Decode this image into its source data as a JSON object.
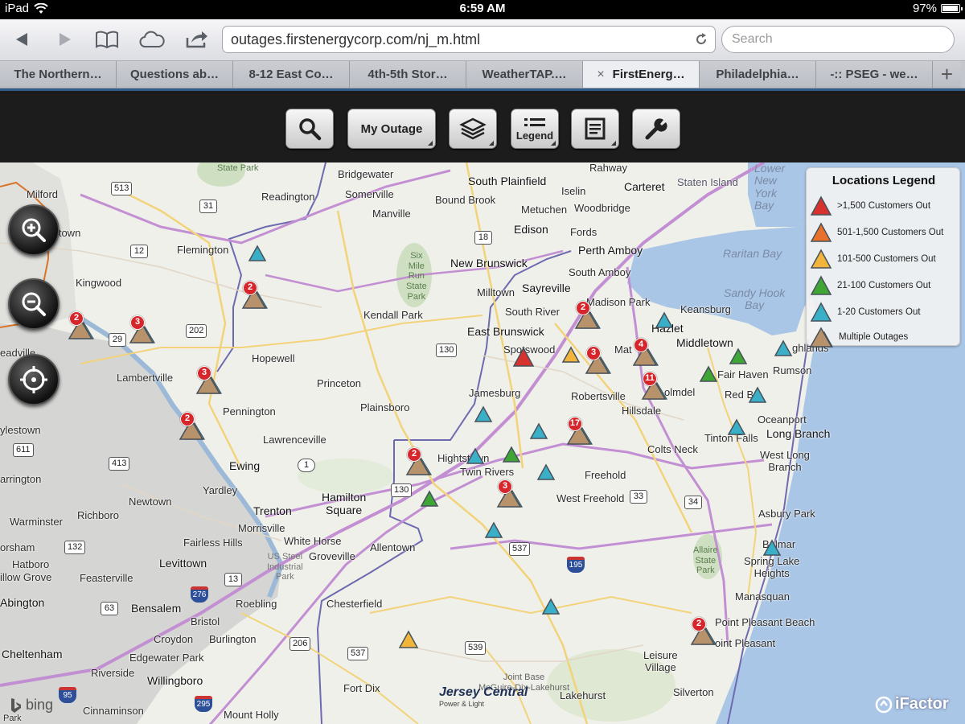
{
  "status": {
    "carrier": "iPad",
    "time": "6:59 AM",
    "battery": "97%",
    "battery_level": 0.97
  },
  "browser": {
    "url": "outages.firstenergycorp.com/nj_m.html",
    "search_placeholder": "Search",
    "tabs": [
      {
        "label": "The Northern…",
        "active": false
      },
      {
        "label": "Questions ab…",
        "active": false
      },
      {
        "label": "8-12 East Co…",
        "active": false
      },
      {
        "label": "4th-5th Stor…",
        "active": false
      },
      {
        "label": "WeatherTAP.…",
        "active": false
      },
      {
        "label": "FirstEnerg…",
        "active": true
      },
      {
        "label": "Philadelphia…",
        "active": false
      },
      {
        "label": "-:: PSEG - we…",
        "active": false
      }
    ],
    "tab_close": "×",
    "tab_add": "+"
  },
  "app_toolbar": {
    "my_outage": "My Outage",
    "legend": "Legend"
  },
  "legend": {
    "title": "Locations Legend",
    "items": [
      {
        "label": ">1,500 Customers Out",
        "color": "#d8322e"
      },
      {
        "label": "501-1,500 Customers Out",
        "color": "#e8702a"
      },
      {
        "label": "101-500 Customers Out",
        "color": "#f0b53a"
      },
      {
        "label": "21-100 Customers Out",
        "color": "#3fa535"
      },
      {
        "label": "1-20 Customers Out",
        "color": "#3ab0c8"
      },
      {
        "label": "Multiple Outages",
        "color": "#b8926a"
      }
    ]
  },
  "places": {
    "bridgewater": "Bridgewater",
    "south_plainfield": "South Plainfield",
    "rahway": "Rahway",
    "carteret": "Carteret",
    "staten_island": "Staten Island",
    "milford": "Milford",
    "readington": "Readington",
    "somerville": "Somerville",
    "bound_brook": "Bound Brook",
    "iselin": "Iselin",
    "metuchen": "Metuchen",
    "woodbridge": "Woodbridge",
    "manville": "Manville",
    "edison": "Edison",
    "fords": "Fords",
    "perth_amboy": "Perth Amboy",
    "flemington": "Flemington",
    "new_brunswick": "New Brunswick",
    "south_amboy": "South Amboy",
    "kingwood": "Kingwood",
    "milltown": "Milltown",
    "sayreville": "Sayreville",
    "madison_park": "Madison Park",
    "keansburg": "Keansburg",
    "south_river": "South River",
    "kendall_park": "Kendall Park",
    "hazlet": "Hazlet",
    "east_brunswick": "East Brunswick",
    "middletown": "Middletown",
    "spotswood": "Spotswood",
    "matawan": "Mat",
    "highlands": "ghlands",
    "hopewell": "Hopewell",
    "lambertville": "Lambertville",
    "fair_haven": "Fair Haven",
    "rumson": "Rumson",
    "princeton": "Princeton",
    "holmdel": "olmdel",
    "red_bank": "Red B",
    "jamesburg": "Jamesburg",
    "robertsville": "Robertsville",
    "pennington": "Pennington",
    "plainsboro": "Plainsboro",
    "hillsdale": "Hillsdale",
    "oceanport": "Oceanport",
    "yardley_w": "ylestown",
    "lawrenceville": "Lawrenceville",
    "tinton_falls": "Tinton Falls",
    "long_branch": "Long Branch",
    "colts_neck": "Colts Neck",
    "hightstown": "Hightstown",
    "ewing": "Ewing",
    "west_long_branch": "West Long\nBranch",
    "twin_rivers": "Twin Rivers",
    "freehold": "Freehold",
    "warrington": "arrington",
    "yardley": "Yardley",
    "hamilton_square": "Hamilton\nSquare",
    "west_freehold": "West Freehold",
    "newtown": "Newtown",
    "trenton": "Trenton",
    "richboro": "Richboro",
    "asbury_park": "Asbury Park",
    "warminster": "Warminster",
    "morrisville": "Morrisville",
    "white_horse": "White Horse",
    "horsham": "orsham",
    "fairless_hills": "Fairless Hills",
    "groveville": "Groveville",
    "allentown": "Allentown",
    "belmar": "Belmar",
    "hatboro": "Hatboro",
    "levittown": "Levittown",
    "spring_lake": "Spring Lake\nHeights",
    "willow_grove": "illow Grove",
    "feasterville": "Feasterville",
    "abington": "Abington",
    "bensalem": "Bensalem",
    "roebling": "Roebling",
    "chesterfield": "Chesterfield",
    "manasquan": "Manasquan",
    "bristol": "Bristol",
    "point_pleasant_beach": "Point Pleasant Beach",
    "croydon": "Croydon",
    "burlington": "Burlington",
    "point_pleasant": "oint Pleasant",
    "cheltenham": "Cheltenham",
    "edgewater_park": "Edgewater Park",
    "leisure_village": "Leisure\nVillage",
    "riverside": "Riverside",
    "willingboro": "Willingboro",
    "fort_dix": "Fort Dix",
    "joint_base": "Joint Base\nMcGuire-Dix-Lakehurst",
    "lakehurst": "Lakehurst",
    "silverton": "Silverton",
    "cinnaminson": "Cinnaminson",
    "mount_holly": "Mount Holly",
    "park_left": "Park",
    "lower_ny_bay": "Lower\nNew\nYork\nBay",
    "raritan_bay": "Raritan Bay",
    "sandy_hook_bay": "Sandy Hook\nBay",
    "six_mile_run": "Six\nMile\nRun\nState\nPark",
    "allaire": "Allaire\nState\nPark",
    "state_park_top": "State\nPark",
    "us_steel": "US Steel\nIndustrial\nPark",
    "edge_doylestown": "eadville",
    "edge_town": "thtown"
  },
  "roads": {
    "r513": "513",
    "r31": "31",
    "r12": "12",
    "r18": "18",
    "r202": "202",
    "r29": "29",
    "r130a": "130",
    "r130b": "130",
    "r1": "1",
    "r611": "611",
    "r413": "413",
    "r132": "132",
    "r33": "33",
    "r34": "34",
    "r537": "537",
    "r13": "13",
    "r276": "276",
    "r195": "195",
    "r63": "63",
    "r206": "206",
    "r539": "539",
    "r537b": "537",
    "r95": "95",
    "r295": "295"
  },
  "outage_markers": [
    {
      "type": "multiple",
      "count": "2"
    },
    {
      "type": "multiple",
      "count": "3"
    },
    {
      "type": "multiple",
      "count": "2"
    },
    {
      "type": "multiple",
      "count": "3"
    },
    {
      "type": "multiple",
      "count": "2"
    },
    {
      "type": "multiple",
      "count": "2"
    },
    {
      "type": "multiple",
      "count": "3"
    },
    {
      "type": "multiple",
      "count": "4"
    },
    {
      "type": "multiple",
      "count": "11"
    },
    {
      "type": "multiple",
      "count": "17"
    },
    {
      "type": "multiple",
      "count": "2"
    },
    {
      "type": "multiple",
      "count": "3"
    },
    {
      "type": "multiple",
      "count": "2"
    }
  ],
  "attribution": {
    "bing": "bing",
    "ifactor": "iFactor",
    "jcpl": "Jersey Central",
    "jcpl_sub": "Power & Light"
  }
}
